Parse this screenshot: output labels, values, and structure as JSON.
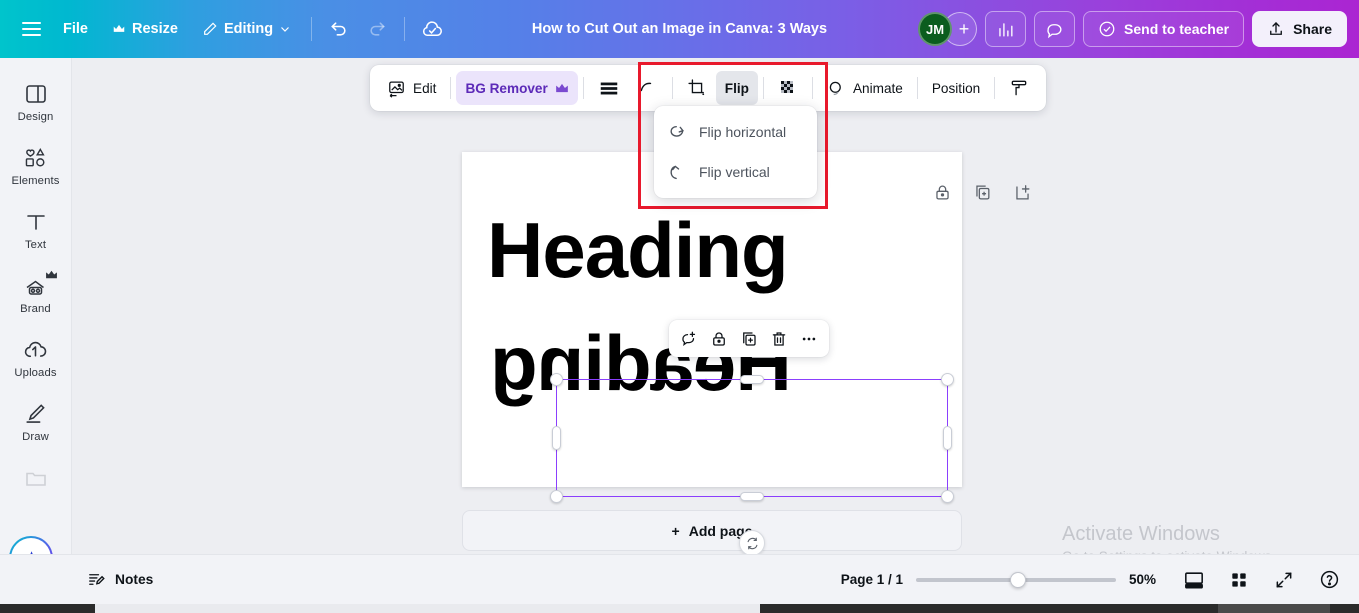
{
  "header": {
    "menu_icon": "hamburger-icon",
    "file_label": "File",
    "resize_label": "Resize",
    "resize_icon": "crown-icon",
    "editing_label": "Editing",
    "editing_icon": "pencil-icon",
    "editing_caret": "chevron-down-icon",
    "undo_icon": "undo-arrow-icon",
    "redo_icon": "redo-arrow-icon",
    "cloud_icon": "cloud-saved-icon",
    "title": "How to Cut Out an Image in Canva: 3 Ways",
    "avatar_initials": "JM",
    "add_member_label": "+",
    "insights_icon": "bar-chart-icon",
    "comment_icon": "speech-bubble-icon",
    "send_label": "Send to teacher",
    "send_icon": "check-circle-icon",
    "share_label": "Share",
    "share_icon": "upload-icon",
    "avatar_color": "#0b5d1e",
    "share_bg": "#f3f0fb"
  },
  "sidebar": {
    "items": [
      {
        "label": "Design",
        "icon": "design-panel-icon"
      },
      {
        "label": "Elements",
        "icon": "shapes-icon"
      },
      {
        "label": "Text",
        "icon": "text-t-icon"
      },
      {
        "label": "Brand",
        "icon": "brand-kit-icon",
        "badge": "crown-icon"
      },
      {
        "label": "Uploads",
        "icon": "cloud-upload-icon"
      },
      {
        "label": "Draw",
        "icon": "pen-draw-icon"
      },
      {
        "label": "",
        "icon": "folder-icon"
      }
    ],
    "ai_button_icon": "magic-sparkle-icon"
  },
  "toolbar": {
    "edit_label": "Edit",
    "edit_icon": "edit-image-icon",
    "bg_remover_label": "BG Remover",
    "bg_remover_badge": "crown-icon",
    "bg_remover_bg": "#ebe4fb",
    "bg_remover_color": "#5c2ab8",
    "transparency_icon": "transparency-bars-icon",
    "curve_icon": "curve-icon",
    "crop_icon": "crop-icon",
    "flip_label": "Flip",
    "flip_active": true,
    "effects_icon": "checkerboard-effects-icon",
    "animate_label": "Animate",
    "animate_icon": "animate-circle-icon",
    "position_label": "Position",
    "paint_icon": "paint-roller-icon"
  },
  "flip_menu": {
    "items": [
      {
        "label": "Flip horizontal",
        "icon": "flip-horizontal-arrow-icon"
      },
      {
        "label": "Flip vertical",
        "icon": "flip-vertical-arrow-icon"
      }
    ],
    "highlight_color": "#e8192c"
  },
  "canvas": {
    "heading_top": "Heading",
    "heading_flipped": "Heading",
    "selection_color": "#8b3ffd",
    "page_icons": [
      {
        "icon": "lock-icon"
      },
      {
        "icon": "duplicate-page-icon"
      },
      {
        "icon": "add-page-icon"
      }
    ],
    "context_toolbar": [
      {
        "icon": "comment-add-icon"
      },
      {
        "icon": "lock-icon"
      },
      {
        "icon": "duplicate-icon"
      },
      {
        "icon": "trash-icon"
      },
      {
        "icon": "more-dots-icon"
      }
    ],
    "rotate_icon": "rotate-icon",
    "add_page_label": "Add page",
    "add_page_plus": "+"
  },
  "watermark": {
    "title": "Activate Windows",
    "subtitle": "Go to Settings to activate Windows."
  },
  "bottombar": {
    "notes_label": "Notes",
    "notes_icon": "notes-icon",
    "page_count": "Page 1 / 1",
    "zoom_value": "50%",
    "zoom_percent": 47,
    "grid_icon": "page-view-icon",
    "thumbnails_icon": "grid-view-icon",
    "fullscreen_icon": "expand-icon",
    "help_icon": "help-circle-icon"
  }
}
